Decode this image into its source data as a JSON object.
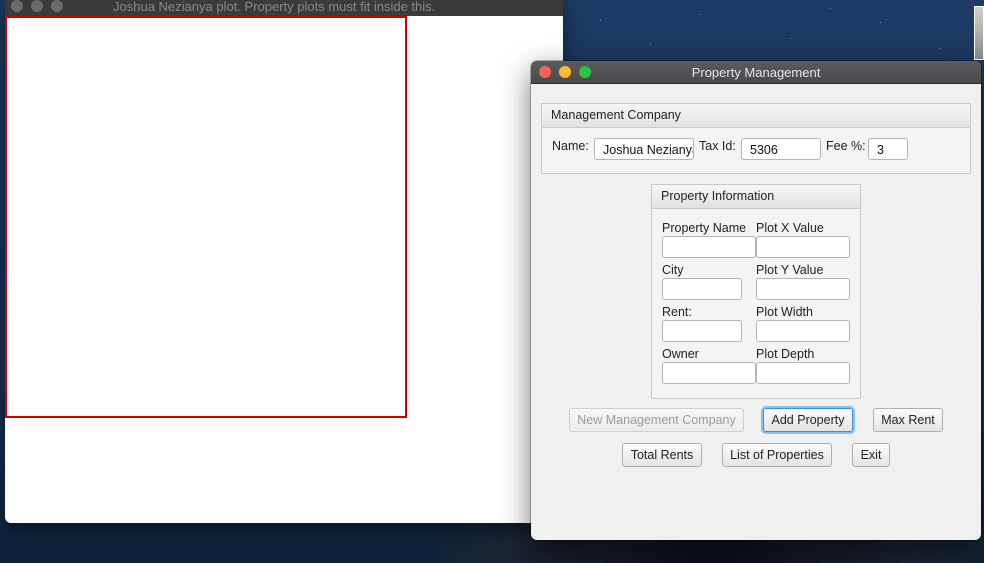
{
  "plot_window": {
    "title": "Joshua Nezianya plot. Property plots must fit inside this."
  },
  "main_window": {
    "title": "Property Management",
    "management_company": {
      "header": "Management Company",
      "name_label": "Name:",
      "name_value": "Joshua Nezianya",
      "tax_id_label": "Tax Id:",
      "tax_id_value": "5306",
      "fee_label": "Fee %:",
      "fee_value": "3"
    },
    "property_information": {
      "header": "Property Information",
      "property_name_label": "Property Name",
      "plot_x_label": "Plot X Value",
      "city_label": "City",
      "plot_y_label": "Plot Y Value",
      "rent_label": "Rent:",
      "plot_width_label": "Plot Width",
      "owner_label": "Owner",
      "plot_depth_label": "Plot Depth",
      "property_name_value": "",
      "plot_x_value": "",
      "city_value": "",
      "plot_y_value": "",
      "rent_value": "",
      "plot_width_value": "",
      "owner_value": "",
      "plot_depth_value": ""
    },
    "buttons": {
      "new_management_company": "New Management Company",
      "add_property": "Add Property",
      "max_rent": "Max Rent",
      "total_rents": "Total Rents",
      "list_of_properties": "List of Properties",
      "exit": "Exit"
    }
  },
  "colors": {
    "plot_border": "#d40000",
    "focus_ring": "#3d8fd6",
    "close": "#fd5f57",
    "minimize": "#febc2e",
    "zoom": "#28c840"
  }
}
